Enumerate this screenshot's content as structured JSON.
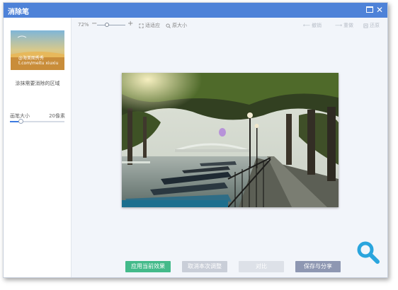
{
  "window": {
    "title": "消除笔",
    "accent_color": "#4e82d8"
  },
  "sidebar": {
    "thumbnail_watermark": "@海美图秀秀",
    "thumbnail_watermark_url": "t.com/meitu xiuxiu",
    "hint": "涂抹需要消除的区域",
    "brush_size_label": "画笔大小",
    "brush_size_value": "20像素",
    "brush_size_fraction": 0.2
  },
  "toolbar": {
    "zoom_percent": "72%",
    "zoom_fraction": 0.35,
    "fit_label": "适适应",
    "original_label": "原大小",
    "undo_label": "撤销",
    "redo_label": "重做",
    "restore_label": "还原"
  },
  "footer": {
    "apply_label": "应用当前效果",
    "cancel_label": "取消本次调整",
    "compare_label": "对比",
    "save_share_label": "保存与分享"
  },
  "icons": [
    "maximize-icon",
    "close-icon",
    "zoom-out-icon",
    "zoom-in-icon",
    "fit-icon",
    "original-size-icon",
    "undo-icon",
    "redo-icon",
    "restore-icon",
    "magnifier-icon"
  ]
}
